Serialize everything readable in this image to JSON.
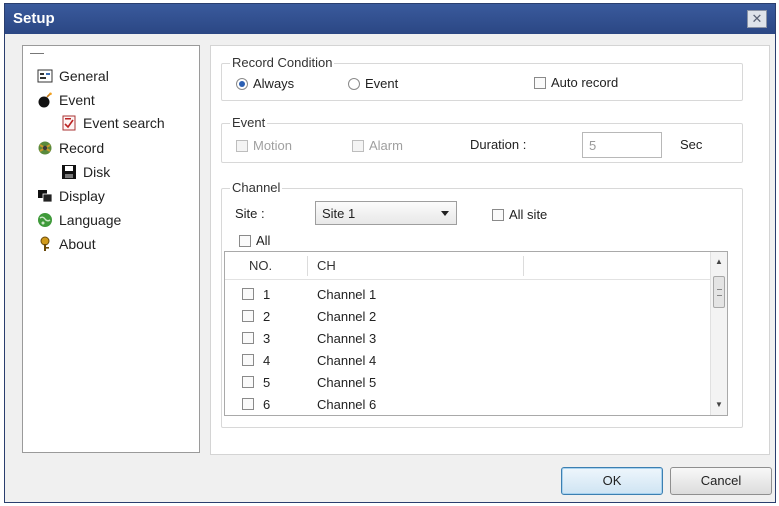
{
  "window": {
    "title": "Setup",
    "close_glyph": "✕"
  },
  "tree": {
    "items": [
      {
        "label": "General",
        "icon": "general-icon"
      },
      {
        "label": "Event",
        "icon": "event-bomb-icon"
      },
      {
        "label": "Event search",
        "icon": "event-search-icon"
      },
      {
        "label": "Record",
        "icon": "record-icon"
      },
      {
        "label": "Disk",
        "icon": "disk-icon"
      },
      {
        "label": "Display",
        "icon": "display-icon"
      },
      {
        "label": "Language",
        "icon": "language-globe-icon"
      },
      {
        "label": "About",
        "icon": "about-key-icon"
      }
    ]
  },
  "record_condition": {
    "title": "Record Condition",
    "always_label": "Always",
    "event_label": "Event",
    "auto_record_label": "Auto record",
    "selected": "Always"
  },
  "event": {
    "title": "Event",
    "motion_label": "Motion",
    "alarm_label": "Alarm",
    "duration_label": "Duration :",
    "duration_value": "5",
    "unit_label": "Sec"
  },
  "channel": {
    "title": "Channel",
    "site_label": "Site :",
    "site_value": "Site 1",
    "all_site_label": "All site",
    "all_label": "All",
    "columns": [
      "NO.",
      "CH"
    ],
    "rows": [
      {
        "no": "1",
        "ch": "Channel 1"
      },
      {
        "no": "2",
        "ch": "Channel 2"
      },
      {
        "no": "3",
        "ch": "Channel 3"
      },
      {
        "no": "4",
        "ch": "Channel 4"
      },
      {
        "no": "5",
        "ch": "Channel 5"
      },
      {
        "no": "6",
        "ch": "Channel 6"
      }
    ]
  },
  "buttons": {
    "ok": "OK",
    "cancel": "Cancel"
  },
  "colors": {
    "titlebar": "#2b4784",
    "accent": "#2b5fb3"
  }
}
